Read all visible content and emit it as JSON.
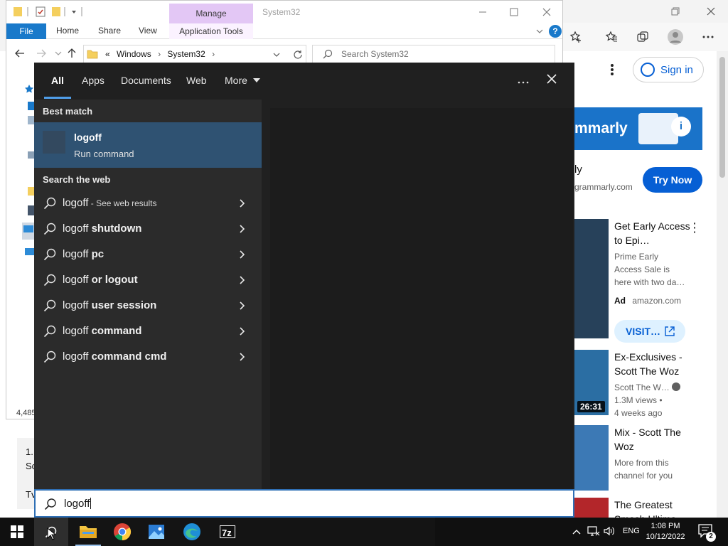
{
  "explorer": {
    "title": "System32",
    "manage_tab": "Manage",
    "ribbon_tabs": [
      "File",
      "Home",
      "Share",
      "View",
      "Application Tools"
    ],
    "address": {
      "prefix": "«",
      "parts": [
        "Windows",
        "System32"
      ]
    },
    "search_placeholder": "Search System32",
    "item_count_fragment": "4,485"
  },
  "browser": {
    "sign_in_label": "Sign in",
    "ad": {
      "brand_fragment": "mmarly",
      "name_fragment": "ly",
      "site_fragment": "grammarly.com",
      "cta": "Try Now"
    },
    "sidebar_items": [
      {
        "title": "Get Early Access to Epi…",
        "meta_lines": [
          "Prime Early",
          "Access Sale is",
          "here with two da…"
        ],
        "ad_label": "Ad",
        "ad_source": "amazon.com",
        "cta": "VISIT…"
      },
      {
        "title": "Ex-Exclusives - Scott The Woz",
        "channel": "Scott The W…",
        "views": "1.3M views •",
        "age": "4 weeks ago",
        "duration": "26:31"
      },
      {
        "title": "Mix - Scott The Woz",
        "meta_lines": [
          "More from this",
          "channel for you"
        ]
      },
      {
        "title": "The Greatest",
        "title_fragment": "Smash Ultima…"
      }
    ],
    "comment_fragment": [
      "1.",
      "Sc",
      "Tv"
    ]
  },
  "search_panel": {
    "tabs": [
      "All",
      "Apps",
      "Documents",
      "Web",
      "More"
    ],
    "best_match_heading": "Best match",
    "best_match": {
      "title": "logoff",
      "subtitle": "Run command"
    },
    "web_heading": "Search the web",
    "web_results": [
      {
        "query": "logoff",
        "suffix": "",
        "note": " - See web results"
      },
      {
        "query": "logoff ",
        "suffix": "shutdown",
        "note": ""
      },
      {
        "query": "logoff ",
        "suffix": "pc",
        "note": ""
      },
      {
        "query": "logoff ",
        "suffix": "or logout",
        "note": ""
      },
      {
        "query": "logoff ",
        "suffix": "user session",
        "note": ""
      },
      {
        "query": "logoff ",
        "suffix": "command",
        "note": ""
      },
      {
        "query": "logoff ",
        "suffix": "command cmd",
        "note": ""
      }
    ],
    "input_value": "logoff"
  },
  "taskbar": {
    "language": "ENG",
    "time": "1:08 PM",
    "date": "10/12/2022",
    "notification_count": "2"
  },
  "icons": {
    "start": "windows-logo-icon",
    "search": "search-icon",
    "file_explorer": "folder-icon",
    "chrome": "chrome-icon",
    "photos": "photos-icon",
    "edge": "edge-icon",
    "sevenzip": "7zip-icon"
  },
  "colors": {
    "accent": "#1979ca",
    "best_match_bg": "#2f5272",
    "panel_bg": "#202020",
    "results_bg": "#2b2b2b",
    "manage_tab": "#e3c7f5",
    "yt_blue": "#065fd4"
  }
}
